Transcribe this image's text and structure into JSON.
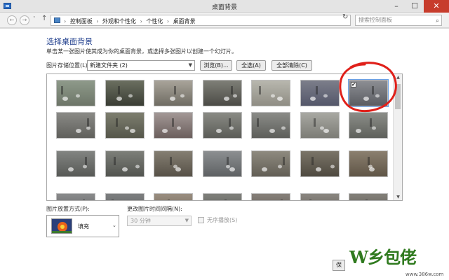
{
  "window": {
    "title": "桌面背景",
    "minimize": "–",
    "maximize": "☐",
    "close": "✕"
  },
  "address_bar": {
    "back": "←",
    "forward": "→",
    "recent": "˅",
    "up": "↑",
    "crumbs": [
      "控制面板",
      "外观和个性化",
      "个性化",
      "桌面背景"
    ],
    "separator": "›",
    "dropdown": "˅",
    "refresh": "↻",
    "search_placeholder": "搜索控制面板",
    "search_icon": "⌕"
  },
  "page": {
    "title": "选择桌面背景",
    "description": "单击某一张图片使其成为你的桌面背景，或选择多张图片以创建一个幻灯片。",
    "location_label": "图片存储位置(L):",
    "location_value": "新建文件夹 (2)",
    "dropdown_arrow": "▼",
    "browse_label": "浏览(B)...",
    "select_all_label": "全选(A)",
    "clear_all_label": "全部清除(C)"
  },
  "gallery": {
    "selected_check": "✔",
    "scroll_up": "▲",
    "scroll_down": "▼",
    "thumbnails": [
      {
        "colors": [
          "#8e9a8a",
          "#6d7568"
        ],
        "selected": false
      },
      {
        "colors": [
          "#6b6f60",
          "#3a3d34"
        ],
        "selected": false
      },
      {
        "colors": [
          "#a9a49a",
          "#6f6c63"
        ],
        "selected": false
      },
      {
        "colors": [
          "#7e7f77",
          "#4c4b46"
        ],
        "selected": false
      },
      {
        "colors": [
          "#b8b7ae",
          "#8f8d84"
        ],
        "selected": false
      },
      {
        "colors": [
          "#7c7e8a",
          "#54576a"
        ],
        "selected": false
      },
      {
        "colors": [
          "#8d8f94",
          "#5a5c62"
        ],
        "selected": true
      },
      {
        "colors": [
          "#8a8a86",
          "#5f5f5b"
        ],
        "selected": false
      },
      {
        "colors": [
          "#7d7e6f",
          "#55564a"
        ],
        "selected": false
      },
      {
        "colors": [
          "#a39896",
          "#6b5f5d"
        ],
        "selected": false
      },
      {
        "colors": [
          "#8a8b85",
          "#5b5c57"
        ],
        "selected": false
      },
      {
        "colors": [
          "#8b8c88",
          "#5d5e5a"
        ],
        "selected": false
      },
      {
        "colors": [
          "#a8a8a2",
          "#7c7c76"
        ],
        "selected": false
      },
      {
        "colors": [
          "#8c8e89",
          "#5e605b"
        ],
        "selected": false
      },
      {
        "colors": [
          "#828481",
          "#575956"
        ],
        "selected": false
      },
      {
        "colors": [
          "#7d7f79",
          "#52544f"
        ],
        "selected": false
      },
      {
        "colors": [
          "#847e72",
          "#575147"
        ],
        "selected": false
      },
      {
        "colors": [
          "#8c8f91",
          "#5e6163"
        ],
        "selected": false
      },
      {
        "colors": [
          "#8e8a7f",
          "#625e55"
        ],
        "selected": false
      },
      {
        "colors": [
          "#7a7468",
          "#4e493f"
        ],
        "selected": false
      },
      {
        "colors": [
          "#8b7f6f",
          "#5f5546"
        ],
        "selected": false
      },
      {
        "colors": [
          "#8a8b8c",
          "#5b5c5d"
        ],
        "selected": false
      },
      {
        "colors": [
          "#7d7f80",
          "#555758"
        ],
        "selected": false
      },
      {
        "colors": [
          "#9a8e80",
          "#6b6054"
        ],
        "selected": false
      },
      {
        "colors": [
          "#7f807b",
          "#555652"
        ],
        "selected": false
      },
      {
        "colors": [
          "#868079",
          "#5a554f"
        ],
        "selected": false
      },
      {
        "colors": [
          "#8a8680",
          "#5f5b55"
        ],
        "selected": false
      },
      {
        "colors": [
          "#838079",
          "#58554f"
        ],
        "selected": false
      }
    ]
  },
  "bottom": {
    "position_label": "图片放置方式(P):",
    "position_value": "填充",
    "position_arrow": "⌄",
    "interval_label": "更改图片时间间隔(N):",
    "interval_value": "30 分钟",
    "interval_arrow": "▼",
    "shuffle_label": "无序播放(S)",
    "save_label": "保"
  },
  "watermark": {
    "logo": "W乡包佬",
    "url": "www.386w.com"
  },
  "colors": {
    "title_accent": "#1e3d8c",
    "close_button": "#c73c2c",
    "annotation": "#e0201a"
  }
}
